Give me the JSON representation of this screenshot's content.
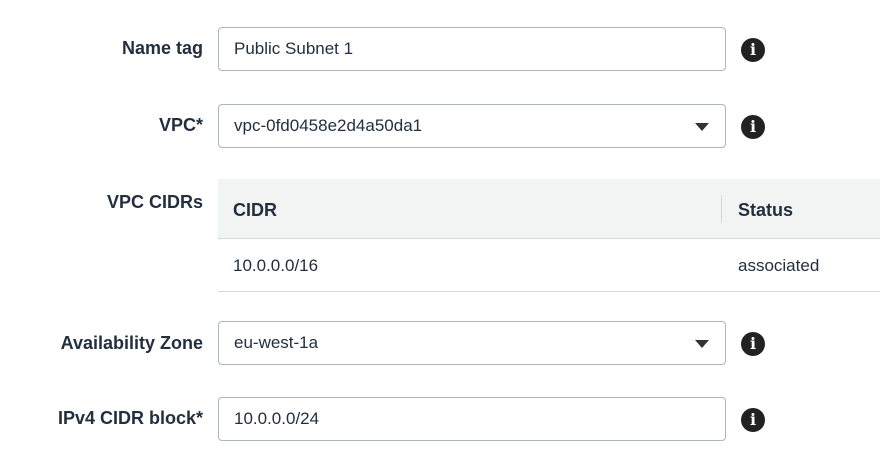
{
  "form": {
    "name_tag": {
      "label": "Name tag",
      "value": "Public Subnet 1"
    },
    "vpc": {
      "label": "VPC*",
      "selected": "vpc-0fd0458e2d4a50da1"
    },
    "vpc_cidrs": {
      "label": "VPC CIDRs",
      "columns": [
        "CIDR",
        "Status"
      ],
      "rows": [
        {
          "cidr": "10.0.0.0/16",
          "status": "associated"
        }
      ]
    },
    "availability_zone": {
      "label": "Availability Zone",
      "selected": "eu-west-1a"
    },
    "ipv4_cidr_block": {
      "label": "IPv4 CIDR block*",
      "value": "10.0.0.0/24"
    }
  },
  "icons": {
    "info": "info-icon",
    "info_glyph": "i",
    "dropdown": "caret-down-icon"
  },
  "colors": {
    "label_text": "#232f3e",
    "field_border": "#aab7b8",
    "table_header_bg": "#f2f3f3",
    "info_icon_bg": "#222222"
  }
}
